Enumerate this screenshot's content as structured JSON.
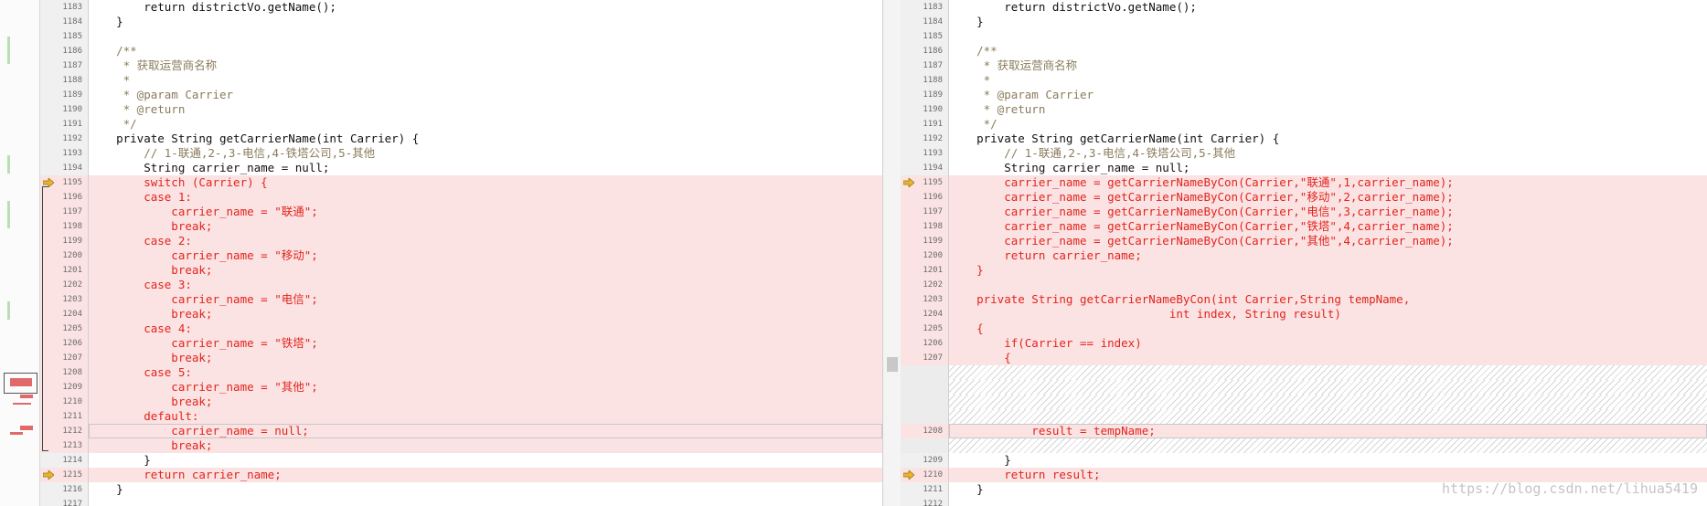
{
  "colors": {
    "diff_bg": "#fbe3e3",
    "changed_text": "#e2241c",
    "comment": "#8a7c5b",
    "arrow": "#e8b52a"
  },
  "watermark": "https://blog.csdn.net/lihua5419",
  "left": {
    "lines": [
      {
        "num": "1183",
        "text": "        return districtVo.getName();",
        "diff": false
      },
      {
        "num": "1184",
        "text": "    }",
        "diff": false
      },
      {
        "num": "1185",
        "text": "",
        "diff": false
      },
      {
        "num": "1186",
        "text": "    /**",
        "diff": false,
        "cls": "cm"
      },
      {
        "num": "1187",
        "text": "     * 获取运营商名称",
        "diff": false,
        "cls": "cm"
      },
      {
        "num": "1188",
        "text": "     *",
        "diff": false,
        "cls": "cm"
      },
      {
        "num": "1189",
        "text": "     * @param Carrier",
        "diff": false,
        "cls": "cm"
      },
      {
        "num": "1190",
        "text": "     * @return",
        "diff": false,
        "cls": "cm"
      },
      {
        "num": "1191",
        "text": "     */",
        "diff": false,
        "cls": "cm"
      },
      {
        "num": "1192",
        "text": "    private String getCarrierName(int Carrier) {",
        "diff": false
      },
      {
        "num": "1193",
        "text": "        // 1-联通,2-,3-电信,4-铁塔公司,5-其他",
        "diff": false,
        "cls": "cm"
      },
      {
        "num": "1194",
        "text": "        String carrier_name = null;",
        "diff": false
      },
      {
        "num": "1195",
        "text": "        switch (Carrier) {",
        "diff": true,
        "arrow": true
      },
      {
        "num": "1196",
        "text": "        case 1:",
        "diff": true
      },
      {
        "num": "1197",
        "text": "            carrier_name = \"联通\";",
        "diff": true
      },
      {
        "num": "1198",
        "text": "            break;",
        "diff": true
      },
      {
        "num": "1199",
        "text": "        case 2:",
        "diff": true
      },
      {
        "num": "1200",
        "text": "            carrier_name = \"移动\";",
        "diff": true
      },
      {
        "num": "1201",
        "text": "            break;",
        "diff": true
      },
      {
        "num": "1202",
        "text": "        case 3:",
        "diff": true
      },
      {
        "num": "1203",
        "text": "            carrier_name = \"电信\";",
        "diff": true
      },
      {
        "num": "1204",
        "text": "            break;",
        "diff": true
      },
      {
        "num": "1205",
        "text": "        case 4:",
        "diff": true
      },
      {
        "num": "1206",
        "text": "            carrier_name = \"铁塔\";",
        "diff": true
      },
      {
        "num": "1207",
        "text": "            break;",
        "diff": true
      },
      {
        "num": "1208",
        "text": "        case 5:",
        "diff": true
      },
      {
        "num": "1209",
        "text": "            carrier_name = \"其他\";",
        "diff": true
      },
      {
        "num": "1210",
        "text": "            break;",
        "diff": true
      },
      {
        "num": "1211",
        "text": "        default:",
        "diff": true
      },
      {
        "num": "1212",
        "text": "            carrier_name = null;",
        "diff": true,
        "boxed": true
      },
      {
        "num": "1213",
        "text": "            break;",
        "diff": true
      },
      {
        "num": "1214",
        "text": "        }",
        "diff": false
      },
      {
        "num": "1215",
        "text": "        return carrier_name;",
        "diff": true,
        "arrow": true
      },
      {
        "num": "1216",
        "text": "    }",
        "diff": false
      },
      {
        "num": "1217",
        "text": "",
        "diff": false
      }
    ]
  },
  "right": {
    "lines": [
      {
        "num": "1183",
        "text": "        return districtVo.getName();",
        "diff": false
      },
      {
        "num": "1184",
        "text": "    }",
        "diff": false
      },
      {
        "num": "1185",
        "text": "",
        "diff": false
      },
      {
        "num": "1186",
        "text": "    /**",
        "diff": false,
        "cls": "cm"
      },
      {
        "num": "1187",
        "text": "     * 获取运营商名称",
        "diff": false,
        "cls": "cm"
      },
      {
        "num": "1188",
        "text": "     *",
        "diff": false,
        "cls": "cm"
      },
      {
        "num": "1189",
        "text": "     * @param Carrier",
        "diff": false,
        "cls": "cm"
      },
      {
        "num": "1190",
        "text": "     * @return",
        "diff": false,
        "cls": "cm"
      },
      {
        "num": "1191",
        "text": "     */",
        "diff": false,
        "cls": "cm"
      },
      {
        "num": "1192",
        "text": "    private String getCarrierName(int Carrier) {",
        "diff": false
      },
      {
        "num": "1193",
        "text": "        // 1-联通,2-,3-电信,4-铁塔公司,5-其他",
        "diff": false,
        "cls": "cm"
      },
      {
        "num": "1194",
        "text": "        String carrier_name = null;",
        "diff": false
      },
      {
        "num": "1195",
        "text": "        carrier_name = getCarrierNameByCon(Carrier,\"联通\",1,carrier_name);",
        "diff": true,
        "arrow": true
      },
      {
        "num": "1196",
        "text": "        carrier_name = getCarrierNameByCon(Carrier,\"移动\",2,carrier_name);",
        "diff": true
      },
      {
        "num": "1197",
        "text": "        carrier_name = getCarrierNameByCon(Carrier,\"电信\",3,carrier_name);",
        "diff": true
      },
      {
        "num": "1198",
        "text": "        carrier_name = getCarrierNameByCon(Carrier,\"铁塔\",4,carrier_name);",
        "diff": true
      },
      {
        "num": "1199",
        "text": "        carrier_name = getCarrierNameByCon(Carrier,\"其他\",4,carrier_name);",
        "diff": true
      },
      {
        "num": "1200",
        "text": "        return carrier_name;",
        "diff": true
      },
      {
        "num": "1201",
        "text": "    }",
        "diff": true
      },
      {
        "num": "1202",
        "text": "",
        "diff": true
      },
      {
        "num": "1203",
        "text": "    private String getCarrierNameByCon(int Carrier,String tempName,",
        "diff": true
      },
      {
        "num": "1204",
        "text": "                                int index, String result)",
        "diff": true
      },
      {
        "num": "1205",
        "text": "    {",
        "diff": true
      },
      {
        "num": "1206",
        "text": "        if(Carrier == index)",
        "diff": true
      },
      {
        "num": "1207",
        "text": "        {",
        "diff": true
      },
      {
        "num": "",
        "text": "",
        "hatch": true
      },
      {
        "num": "",
        "text": "",
        "hatch": true
      },
      {
        "num": "",
        "text": "",
        "hatch": true
      },
      {
        "num": "",
        "text": "",
        "hatch": true
      },
      {
        "num": "1208",
        "text": "            result = tempName;",
        "diff": true,
        "boxed": true
      },
      {
        "num": "",
        "text": "",
        "hatch": true
      },
      {
        "num": "1209",
        "text": "        }",
        "diff": false
      },
      {
        "num": "1210",
        "text": "        return result;",
        "diff": true,
        "arrow": true
      },
      {
        "num": "1211",
        "text": "    }",
        "diff": false
      },
      {
        "num": "1212",
        "text": "",
        "diff": false
      }
    ]
  }
}
